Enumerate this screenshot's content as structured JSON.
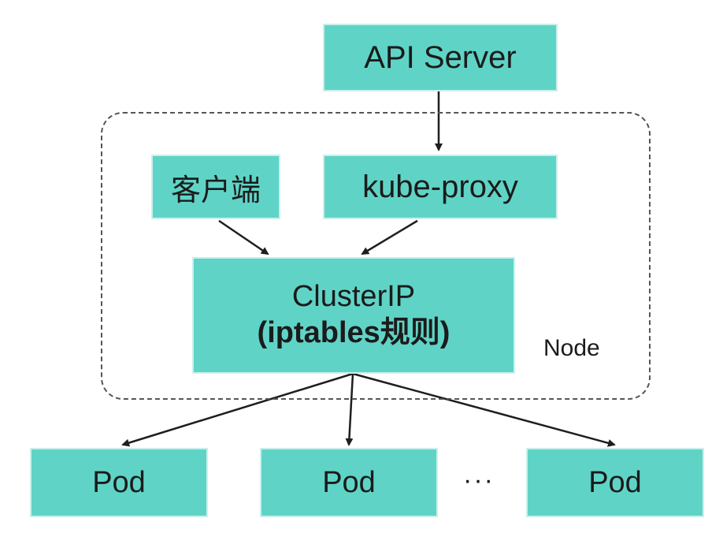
{
  "colors": {
    "box_fill": "#5fd4c6",
    "box_border": "#c9f0eb",
    "arrow": "#1e1e1e",
    "frame": "#555555"
  },
  "api_server": {
    "label": "API Server"
  },
  "client": {
    "label": "客户端"
  },
  "kube_proxy": {
    "label": "kube-proxy"
  },
  "cluster_ip": {
    "label": "ClusterIP",
    "sublabel": "(iptables规则)"
  },
  "node": {
    "label": "Node"
  },
  "pods": [
    {
      "label": "Pod"
    },
    {
      "label": "Pod"
    },
    {
      "label": "Pod"
    }
  ],
  "ellipsis": "···"
}
